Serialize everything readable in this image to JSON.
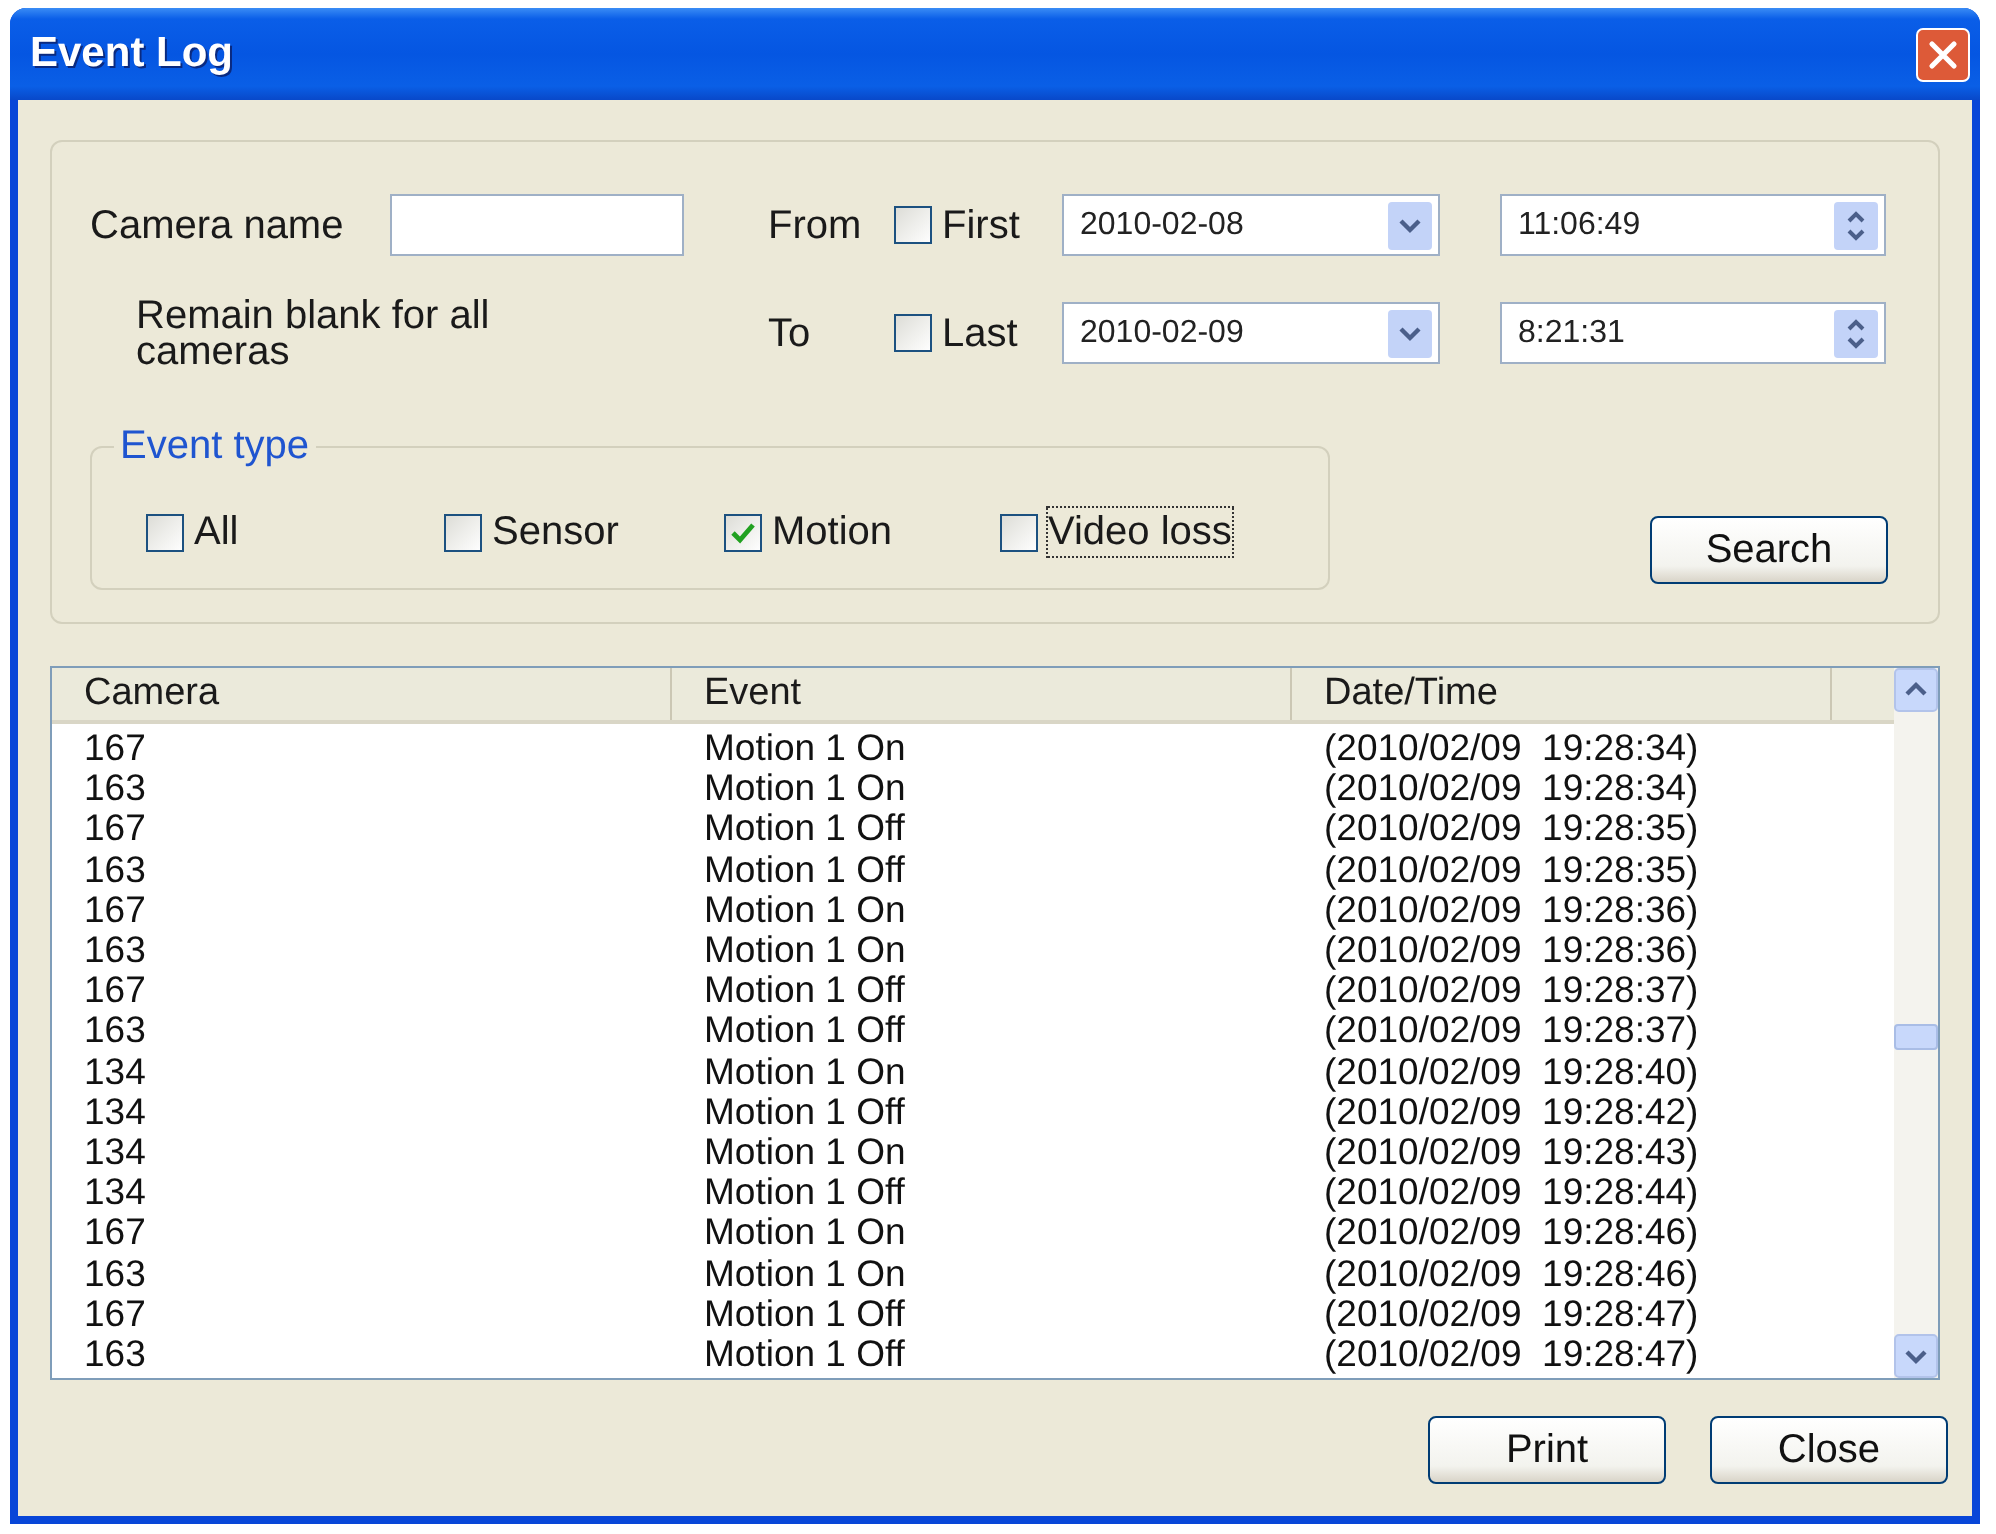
{
  "window": {
    "title": "Event Log"
  },
  "filter": {
    "camera_name": {
      "label": "Camera name"
    },
    "hint": "Remain blank for all cameras",
    "from": {
      "label": "From",
      "bound": {
        "label": "First",
        "checked": false
      },
      "date": "2010-02-08",
      "time": "11:06:49"
    },
    "to": {
      "label": "To",
      "bound": {
        "label": "Last",
        "checked": false
      },
      "date": "2010-02-09",
      "time": "8:21:31"
    }
  },
  "event_type": {
    "title": "Event type",
    "options": [
      {
        "label": "All",
        "checked": false,
        "focused": false
      },
      {
        "label": "Sensor",
        "checked": false,
        "focused": false
      },
      {
        "label": "Motion",
        "checked": true,
        "focused": false
      },
      {
        "label": "Video loss",
        "checked": false,
        "focused": true
      }
    ]
  },
  "search_button": "Search",
  "table": {
    "columns": [
      "Camera",
      "Event",
      "Date/Time"
    ],
    "rows": [
      [
        "167",
        "Motion 1 On",
        "(2010/02/09  19:28:34)"
      ],
      [
        "163",
        "Motion 1 On",
        "(2010/02/09  19:28:34)"
      ],
      [
        "167",
        "Motion 1 Off",
        "(2010/02/09  19:28:35)"
      ],
      [
        "163",
        "Motion 1 Off",
        "(2010/02/09  19:28:35)"
      ],
      [
        "167",
        "Motion 1 On",
        "(2010/02/09  19:28:36)"
      ],
      [
        "163",
        "Motion 1 On",
        "(2010/02/09  19:28:36)"
      ],
      [
        "167",
        "Motion 1 Off",
        "(2010/02/09  19:28:37)"
      ],
      [
        "163",
        "Motion 1 Off",
        "(2010/02/09  19:28:37)"
      ],
      [
        "134",
        "Motion 1 On",
        "(2010/02/09  19:28:40)"
      ],
      [
        "134",
        "Motion 1 Off",
        "(2010/02/09  19:28:42)"
      ],
      [
        "134",
        "Motion 1 On",
        "(2010/02/09  19:28:43)"
      ],
      [
        "134",
        "Motion 1 Off",
        "(2010/02/09  19:28:44)"
      ],
      [
        "167",
        "Motion 1 On",
        "(2010/02/09  19:28:46)"
      ],
      [
        "163",
        "Motion 1 On",
        "(2010/02/09  19:28:46)"
      ],
      [
        "167",
        "Motion 1 Off",
        "(2010/02/09  19:28:47)"
      ],
      [
        "163",
        "Motion 1 Off",
        "(2010/02/09  19:28:47)"
      ]
    ]
  },
  "buttons": [
    "Print",
    "Close"
  ]
}
